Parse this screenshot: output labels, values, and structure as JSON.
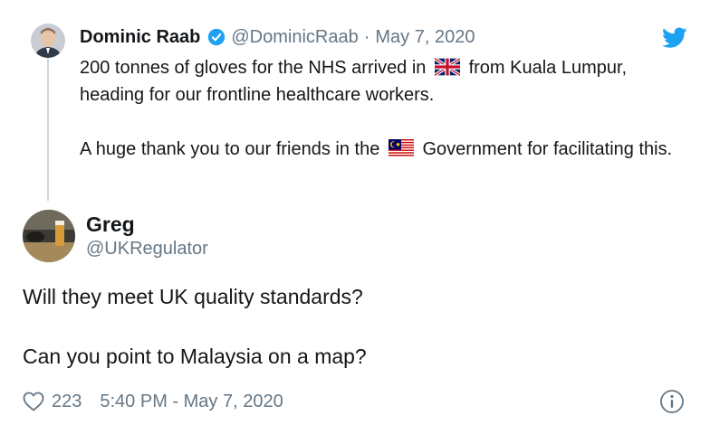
{
  "parent_tweet": {
    "author_name": "Dominic Raab",
    "handle": "@DominicRaab",
    "separator": "·",
    "date": "May 7, 2020",
    "text_line1_before_flag": "200 tonnes of gloves for the NHS arrived in",
    "flag1": "uk-flag",
    "text_line1_after_flag": "from Kuala Lumpur, heading for our frontline healthcare workers.",
    "text_para2_before_flag": "A huge thank you to our friends in the",
    "flag2": "malaysia-flag",
    "text_para2_after_flag": "Government for facilitating this."
  },
  "reply_tweet": {
    "author_name": "Greg",
    "handle": "@UKRegulator",
    "paragraphs": [
      "Will they meet UK quality standards?",
      "Can you point to Malaysia on a map?"
    ],
    "like_count": "223",
    "timestamp": "5:40 PM - May 7, 2020"
  },
  "icons": {
    "verified": "verified-badge-icon",
    "brand": "twitter-bird-icon",
    "like": "heart-icon",
    "info": "info-icon"
  },
  "colors": {
    "twitter_blue": "#1da1f2",
    "muted_text": "#657786",
    "thread_line": "#ccd6dd"
  }
}
